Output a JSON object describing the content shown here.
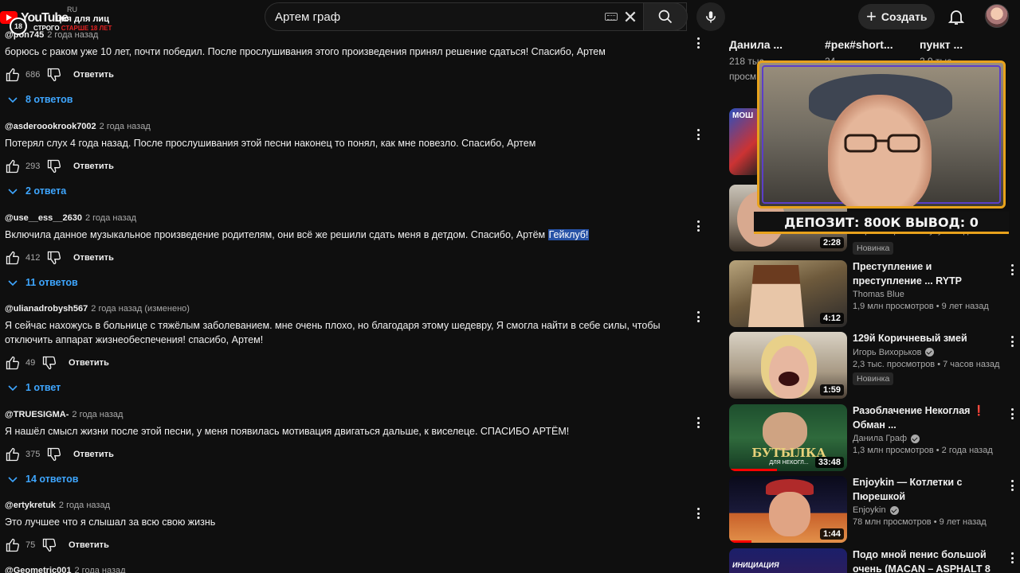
{
  "header": {
    "logo_text": "YouTube",
    "logo_region": "RU",
    "age_badge": "18",
    "logo_line1": "ция для лиц",
    "logo_line2_white": "СТРОГО ",
    "logo_line2_red": "СТАРШЕ 18 ЛЕТ",
    "search_value": "Артем граф",
    "create_label": "Создать"
  },
  "comments": [
    {
      "author": "@pon745",
      "time": "2 года назад",
      "text": "борюсь с раком уже 10 лет, почти победил. После прослушивания этого произведения принял решение сдаться! Спасибо, Артем",
      "likes": "686",
      "reply": "Ответить",
      "replies": "8 ответов"
    },
    {
      "author": "@asderoookrook7002",
      "time": "2 года назад",
      "text": "Потерял слух 4 года назад. После прослушивания этой песни наконец то понял, как мне повезло. Спасибо, Артем",
      "likes": "293",
      "reply": "Ответить",
      "replies": "2 ответа"
    },
    {
      "author": "@use__ess__2630",
      "time": "2 года назад",
      "text": "Включила данное музыкальное произведение родителям, они всё же решили сдать меня в детдом. Спасибо, Артём ",
      "highlight": "Гейклуб!",
      "likes": "412",
      "reply": "Ответить",
      "replies": "11 ответов"
    },
    {
      "author": "@ulianadrobysh567",
      "time": "2 года назад (изменено)",
      "text": "Я сейчас нахожусь в больнице с тяжёлым заболеванием. мне очень плохо, но благодаря этому шедевру, Я смогла найти в себе силы, чтобы отключить аппарат жизнеобеспечения! спасибо, Артем!",
      "likes": "49",
      "reply": "Ответить",
      "replies": "1 ответ"
    },
    {
      "author": "@TRUESIGMA-",
      "time": "2 года назад",
      "text": "Я нашёл смысл жизни после этой песни, у меня появилась мотивация двигаться дальше, к виселеце. СПАСИБО АРТЁМ!",
      "likes": "375",
      "reply": "Ответить",
      "replies": "14 ответов"
    },
    {
      "author": "@ertykretuk",
      "time": "2 года назад",
      "text": "Это лучшее что я слышал за всю свою жизнь",
      "likes": "75",
      "reply": "Ответить"
    },
    {
      "author": "@Geometric001",
      "time": "2 года назад"
    }
  ],
  "sidebar": {
    "chips": [
      {
        "label": "Данила ...",
        "sub": "218 тыс."
      },
      {
        "label": "#рек#short...",
        "sub": "24"
      },
      {
        "label": "пункт ...",
        "sub": "2,9 тыс."
      }
    ],
    "chip_sub2": "просм",
    "videos": [
      {
        "duration": "2:28",
        "stats": "1 просмотр • 1 минуту назад",
        "badge": "Новинка"
      },
      {
        "title": "Преступление и преступление ... RYTP",
        "channel": "Thomas Blue",
        "stats": "1,9 млн просмотров • 9 лет назад",
        "duration": "4:12"
      },
      {
        "title": "129й Коричневый змей",
        "channel": "Игорь Вихорьков",
        "stats": "2,3 тыс. просмотров • 7 часов назад",
        "duration": "1:59",
        "badge": "Новинка"
      },
      {
        "title": "Разоблачение Некоглая ❗ Обман ...",
        "channel": "Данила Граф",
        "stats": "1,3 млн просмотров • 2 года назад",
        "duration": "33:48",
        "thumb_text": "БУТЫЛКА",
        "thumb_sub": "ДЛЯ НЕКОГЛ..."
      },
      {
        "title": "Enjoykin — Котлетки с Пюрешкой",
        "channel": "Enjoykin",
        "stats": "78 млн просмотров • 9 лет назад",
        "duration": "1:44"
      },
      {
        "title": "Подо мной пенис большой очень (MACAN – ASPHALT 8 ...",
        "thumb_text": "ИНИЦИАЦИЯ"
      }
    ],
    "thumb2_label": "МОШ"
  },
  "webcam": {
    "caption": "ДЕПОЗИТ: 800К   ВЫВОД: 0"
  },
  "colors": {
    "background": "#0f0f0f",
    "link_blue": "#3ea6ff",
    "highlight": "#2752a6",
    "yt_red": "#ff0000",
    "cam_border": "#e8a21c"
  }
}
